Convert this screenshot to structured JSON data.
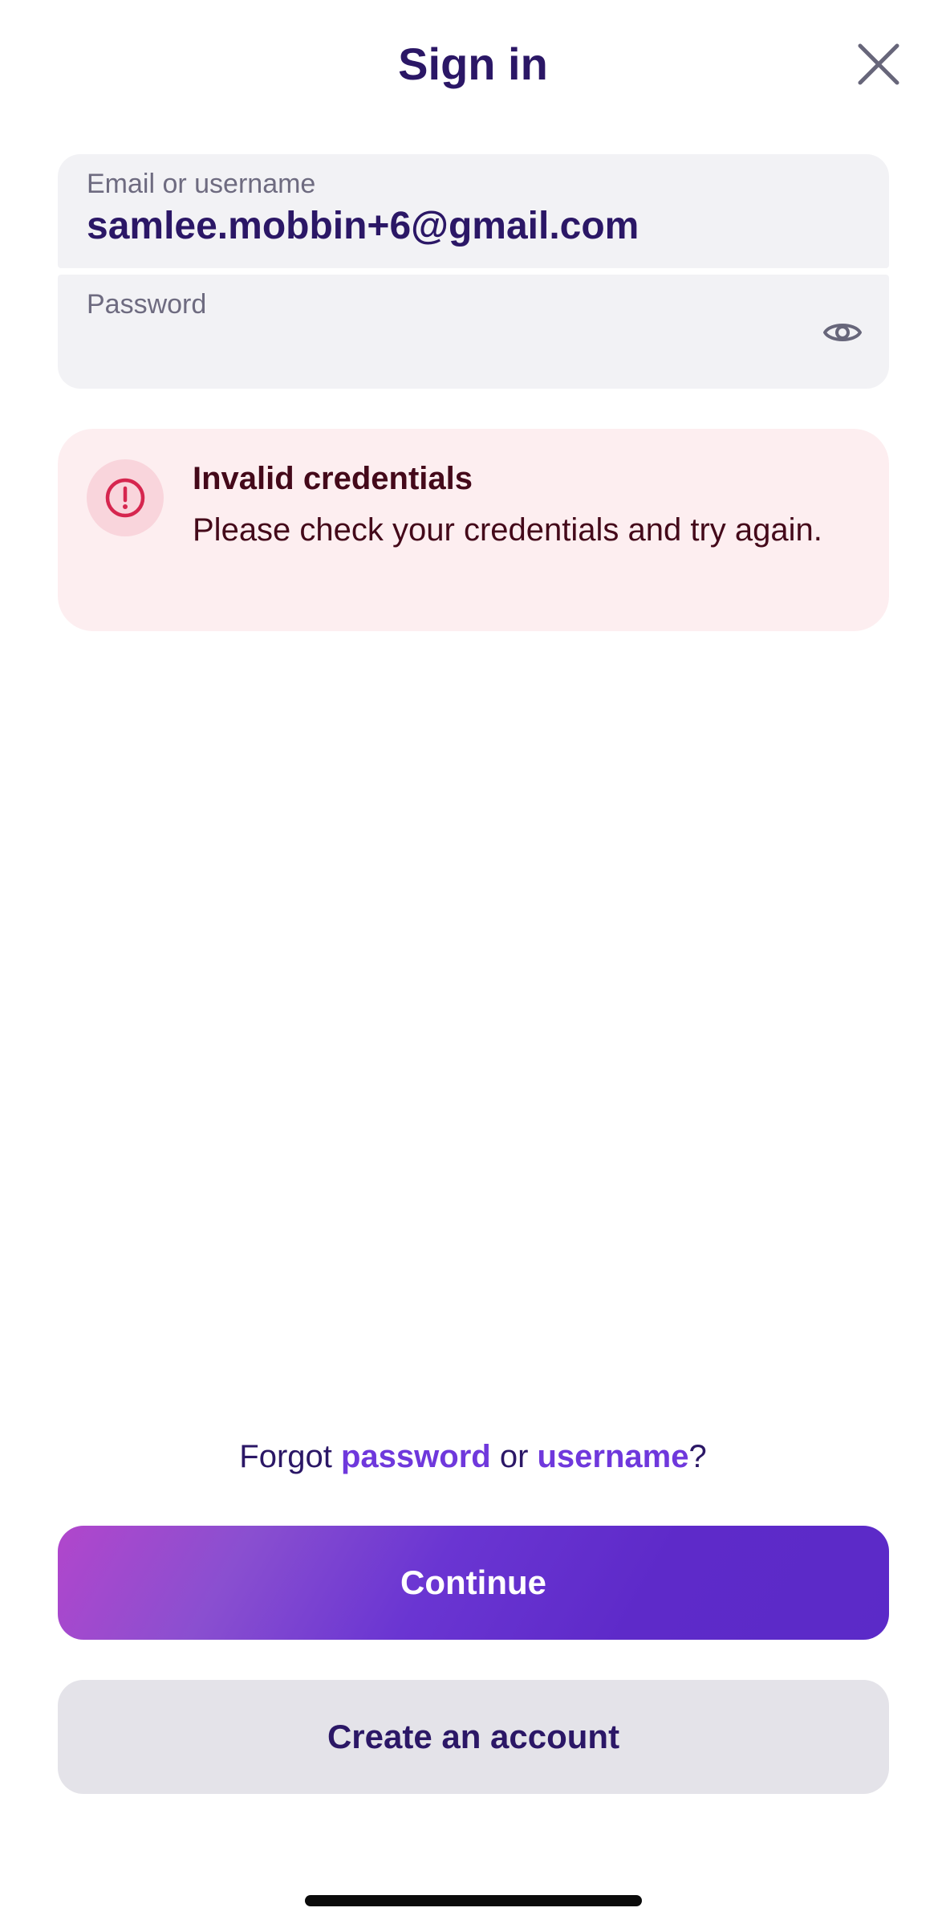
{
  "header": {
    "title": "Sign in"
  },
  "form": {
    "email": {
      "label": "Email or username",
      "value": "samlee.mobbin+6@gmail.com"
    },
    "password": {
      "label": "Password",
      "value": ""
    }
  },
  "error": {
    "title": "Invalid credentials",
    "message": "Please check your credentials and try again."
  },
  "forgot": {
    "prefix": "Forgot ",
    "password_link": "password",
    "middle": " or ",
    "username_link": "username",
    "suffix": "?"
  },
  "buttons": {
    "continue": "Continue",
    "create_account": "Create an account"
  },
  "icons": {
    "close": "close-icon",
    "eye": "eye-icon",
    "alert": "alert-circle-icon"
  },
  "colors": {
    "text_primary": "#2b1766",
    "link": "#6f38dc",
    "error_bg": "#fdeef0",
    "error_icon": "#d6264f",
    "button_primary": "#5e2ac9",
    "button_secondary": "#e4e3e9"
  }
}
